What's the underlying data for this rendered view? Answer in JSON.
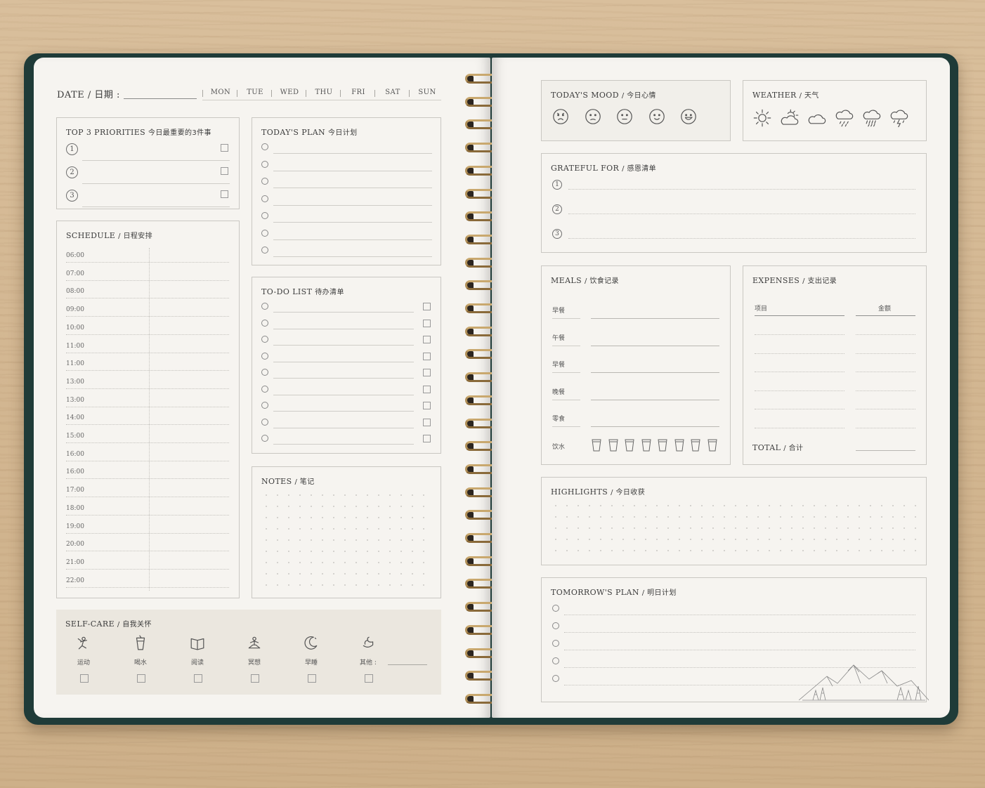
{
  "left": {
    "date": {
      "label": "DATE / 日期 :",
      "days": [
        "MON",
        "TUE",
        "WED",
        "THU",
        "FRI",
        "SAT",
        "SUN"
      ]
    },
    "priorities": {
      "title": "TOP 3 PRIORITIES",
      "title_cn": "今日最重要的3件事",
      "items": [
        "1",
        "2",
        "3"
      ]
    },
    "todays_plan": {
      "title": "TODAY'S PLAN",
      "title_cn": "今日计划",
      "rows": 7
    },
    "schedule": {
      "title": "SCHEDULE",
      "title_cn": "/ 日程安排",
      "hours": [
        "06:00",
        "07:00",
        "08:00",
        "09:00",
        "10:00",
        "11:00",
        "11:00",
        "13:00",
        "13:00",
        "14:00",
        "15:00",
        "16:00",
        "16:00",
        "17:00",
        "18:00",
        "19:00",
        "20:00",
        "21:00",
        "22:00"
      ]
    },
    "todo": {
      "title": "TO-DO LIST",
      "title_cn": "待办清单",
      "rows": 9
    },
    "notes": {
      "title": "NOTES",
      "title_cn": "/ 笔记"
    },
    "selfcare": {
      "title": "SELF-CARE",
      "title_cn": "/ 自我关怀",
      "items": [
        {
          "label": "运动",
          "icon": "exercise-icon"
        },
        {
          "label": "喝水",
          "icon": "water-cup-icon"
        },
        {
          "label": "阅读",
          "icon": "book-icon"
        },
        {
          "label": "冥想",
          "icon": "meditation-icon"
        },
        {
          "label": "早睡",
          "icon": "moon-icon"
        },
        {
          "label": "其他 :",
          "icon": "hand-icon"
        }
      ]
    }
  },
  "right": {
    "mood": {
      "title": "TODAY'S MOOD",
      "title_cn": "/ 今日心情",
      "faces": [
        "very-sad-face-icon",
        "sad-face-icon",
        "neutral-face-icon",
        "smile-face-icon",
        "happy-face-icon"
      ]
    },
    "weather": {
      "title": "WEATHER",
      "title_cn": "/ 天气",
      "icons": [
        "sun-icon",
        "partly-cloudy-icon",
        "cloud-icon",
        "rain-icon",
        "heavy-rain-icon",
        "storm-icon"
      ]
    },
    "grateful": {
      "title": "GRATEFUL FOR",
      "title_cn": "/ 感恩清单",
      "items": [
        "1",
        "2",
        "3"
      ]
    },
    "meals": {
      "title": "MEALS",
      "title_cn": "/ 饮食记录",
      "rows": [
        "早餐",
        "午餐",
        "早餐",
        "晚餐",
        "零食"
      ],
      "water_label": "饮水",
      "cups": 8
    },
    "expenses": {
      "title": "EXPENSES",
      "title_cn": "/ 支出记录",
      "col_item": "项目",
      "col_amount": "金额",
      "total": "TOTAL",
      "total_cn": "/ 合计"
    },
    "highlights": {
      "title": "HIGHLIGHTS",
      "title_cn": "/ 今日收获"
    },
    "tomorrow": {
      "title": "TOMORROW'S PLAN",
      "title_cn": "/ 明日计划",
      "rows": 5
    }
  },
  "colors": {
    "cover": "#1f3b38",
    "paper": "#f6f4f0",
    "wire": "#b08f58",
    "desk": "#d6ba95"
  }
}
